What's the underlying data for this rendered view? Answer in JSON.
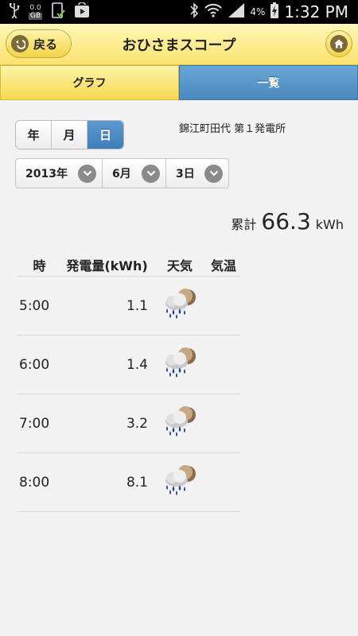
{
  "status_bar": {
    "data_amount": "0.0",
    "data_unit": "GB",
    "battery_percent": "4%",
    "time": "1:32 PM"
  },
  "header": {
    "back_label": "戻る",
    "title": "おひさまスコープ"
  },
  "tabs": [
    {
      "label": "グラフ",
      "active": true
    },
    {
      "label": "一覧",
      "active": false
    }
  ],
  "period": {
    "options": [
      "年",
      "月",
      "日"
    ],
    "selected": "日"
  },
  "plant_name": "錦江町田代 第１発電所",
  "date_select": {
    "year": "2013年",
    "month": "6月",
    "day": "3日"
  },
  "total": {
    "label": "累計",
    "value": "66.3",
    "unit": "kWh"
  },
  "table": {
    "headers": [
      "時",
      "発電量(kWh)",
      "天気",
      "気温"
    ],
    "rows": [
      {
        "time": "5:00",
        "kwh": "1.1",
        "weather": "cloud-rain-night-icon",
        "temp": ""
      },
      {
        "time": "6:00",
        "kwh": "1.4",
        "weather": "cloud-rain-night-icon",
        "temp": ""
      },
      {
        "time": "7:00",
        "kwh": "3.2",
        "weather": "cloud-rain-night-icon",
        "temp": ""
      },
      {
        "time": "8:00",
        "kwh": "8.1",
        "weather": "cloud-rain-night-icon",
        "temp": ""
      }
    ]
  },
  "colors": {
    "header_yellow": "#fbe36e",
    "tab_blue": "#4a88c0",
    "active_segment": "#3d7dbb"
  }
}
